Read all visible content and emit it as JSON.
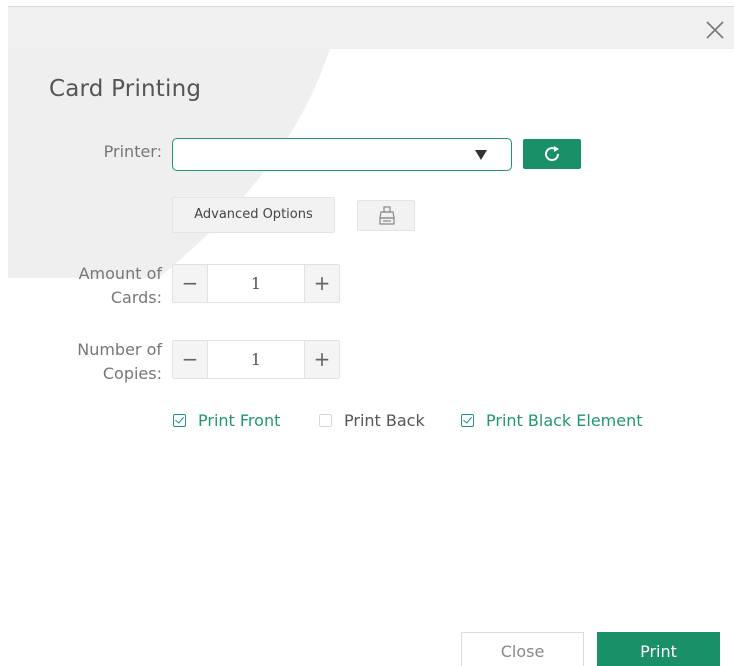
{
  "dialog": {
    "title": "Card Printing",
    "close_icon": "close-icon"
  },
  "printer": {
    "label": "Printer:",
    "selected_value": "",
    "dropdown_icon": "caret-down-icon",
    "refresh_icon": "refresh-icon"
  },
  "advanced": {
    "label": "Advanced Options",
    "clean_icon": "printer-clean-icon"
  },
  "amount_of_cards": {
    "label_line1": "Amount of",
    "label_line2": "Cards:",
    "value": "1",
    "minus": "−",
    "plus": "+"
  },
  "number_of_copies": {
    "label_line1": "Number of",
    "label_line2": "Copies:",
    "value": "1",
    "minus": "−",
    "plus": "+"
  },
  "options": [
    {
      "label": "Print Front",
      "checked": true
    },
    {
      "label": "Print Back",
      "checked": false
    },
    {
      "label": "Print Black Element",
      "checked": true
    }
  ],
  "footer": {
    "close_label": "Close",
    "print_label": "Print"
  },
  "colors": {
    "accent": "#1a9068"
  }
}
